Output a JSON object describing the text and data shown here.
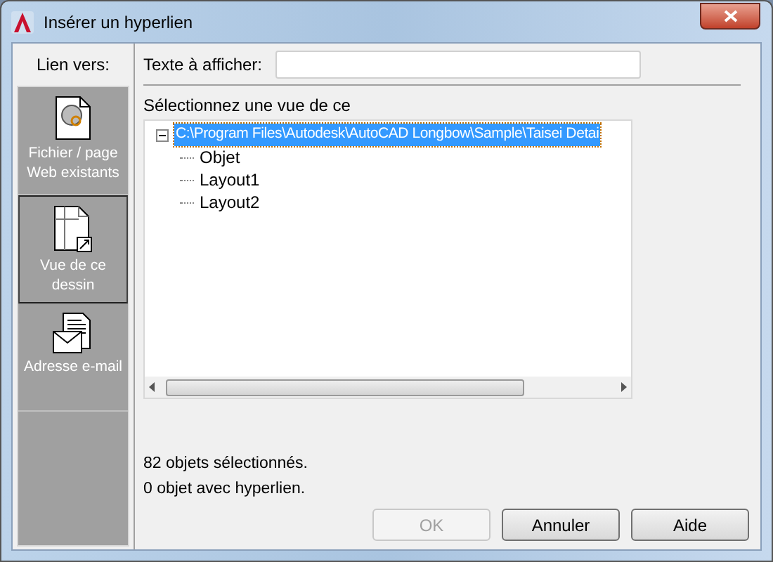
{
  "window": {
    "title": "Insérer un hyperlien"
  },
  "link_to": {
    "label": "Lien vers:"
  },
  "sidebar": {
    "items": [
      {
        "label": "Fichier / page Web existants",
        "kind": "file",
        "selected": false
      },
      {
        "label": "Vue de ce dessin",
        "kind": "view",
        "selected": true
      },
      {
        "label": "Adresse e-mail",
        "kind": "email",
        "selected": false
      }
    ]
  },
  "display_text": {
    "label": "Texte à afficher:"
  },
  "tree": {
    "label": "Sélectionnez une vue de ce",
    "items": [
      {
        "label": "C:\\Program Files\\Autodesk\\AutoCAD Longbow\\Sample\\Taisei Detai",
        "selected": true,
        "expanded": true,
        "children": [
          {
            "label": "Objet",
            "selected": false
          },
          {
            "label": "Layout1",
            "selected": false
          },
          {
            "label": "Layout2",
            "selected": false
          }
        ]
      }
    ]
  },
  "status": [
    "82 objets sélectionnés.",
    "0 objet avec hyperlien."
  ],
  "buttons": [
    {
      "label": "OK",
      "disabled": true
    },
    {
      "label": "Annuler",
      "disabled": false
    },
    {
      "label": "Aide",
      "disabled": false
    }
  ]
}
